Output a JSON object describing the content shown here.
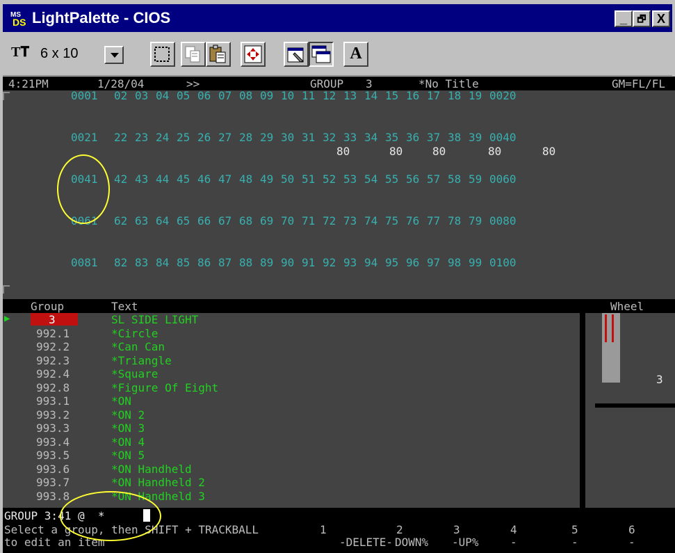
{
  "window": {
    "app_icon": "ms-dos-icon",
    "title": "LightPalette - CIOS",
    "buttons": {
      "minimize": "_",
      "maximize": "🗗",
      "close": "X"
    }
  },
  "toolbar": {
    "font_icon": "truetype-icon",
    "font_size": "6 x 10",
    "buttons": [
      "select-icon",
      "copy-icon",
      "paste-icon",
      "fullscreen-icon",
      "properties-icon",
      "background-icon",
      "font-icon"
    ],
    "font_button_label": "A"
  },
  "status_header": {
    "time": "4:21PM",
    "date": "1/28/04",
    "arrows": ">>",
    "mode": "GROUP",
    "mode_value": "3",
    "show_title": "*No Title",
    "gm": "GM=FL/FL"
  },
  "channels": {
    "rows": [
      [
        "0001",
        "02",
        "03",
        "04",
        "05",
        "06",
        "07",
        "08",
        "09",
        "10",
        "11",
        "12",
        "13",
        "14",
        "15",
        "16",
        "17",
        "18",
        "19",
        "0020"
      ],
      [
        "0021",
        "22",
        "23",
        "24",
        "25",
        "26",
        "27",
        "28",
        "29",
        "30",
        "31",
        "32",
        "33",
        "34",
        "35",
        "36",
        "37",
        "38",
        "39",
        "0040"
      ],
      [
        "0041",
        "42",
        "43",
        "44",
        "45",
        "46",
        "47",
        "48",
        "49",
        "50",
        "51",
        "52",
        "53",
        "54",
        "55",
        "56",
        "57",
        "58",
        "59",
        "0060"
      ],
      [
        "0061",
        "62",
        "63",
        "64",
        "65",
        "66",
        "67",
        "68",
        "69",
        "70",
        "71",
        "72",
        "73",
        "74",
        "75",
        "76",
        "77",
        "78",
        "79",
        "0080"
      ],
      [
        "0081",
        "82",
        "83",
        "84",
        "85",
        "86",
        "87",
        "88",
        "89",
        "90",
        "91",
        "92",
        "93",
        "94",
        "95",
        "96",
        "97",
        "98",
        "99",
        "0100"
      ]
    ],
    "levels_row2": [
      "80",
      "80",
      "80",
      "80",
      "80"
    ]
  },
  "list": {
    "col_group": "Group",
    "col_text": "Text",
    "col_wheel": "Wheel",
    "wheel_value": "3",
    "items": [
      {
        "group": "3",
        "text": "SL SIDE LIGHT",
        "selected": true
      },
      {
        "group": "992.1",
        "text": "*Circle"
      },
      {
        "group": "992.2",
        "text": "*Can Can"
      },
      {
        "group": "992.3",
        "text": "*Triangle"
      },
      {
        "group": "992.4",
        "text": "*Square"
      },
      {
        "group": "992.8",
        "text": "*Figure Of Eight"
      },
      {
        "group": "993.1",
        "text": "*ON"
      },
      {
        "group": "993.2",
        "text": "*ON 2"
      },
      {
        "group": "993.3",
        "text": "*ON 3"
      },
      {
        "group": "993.4",
        "text": "*ON 4"
      },
      {
        "group": "993.5",
        "text": "*ON 5"
      },
      {
        "group": "993.6",
        "text": "*ON Handheld"
      },
      {
        "group": "993.7",
        "text": "*ON Handheld 2"
      },
      {
        "group": "993.8",
        "text": "*ON Handheld 3"
      }
    ]
  },
  "command_line": "GROUP 3:41 @  *",
  "prompt": {
    "line1": "Select a group, then SHIFT + TRACKBALL",
    "line2": "to edit an item"
  },
  "softkeys": {
    "numbers": [
      "1",
      "2",
      "3",
      "4",
      "5",
      "6"
    ],
    "labels": [
      "-DELETE-",
      "DOWN%",
      "-UP%",
      "-",
      "-",
      "-"
    ]
  },
  "colors": {
    "title_bar": "#000080",
    "screen_bg": "#434343",
    "channel": "#38b0b0",
    "group_text": "#22d022",
    "selection": "#c01010",
    "annotation": "#ffff33"
  }
}
